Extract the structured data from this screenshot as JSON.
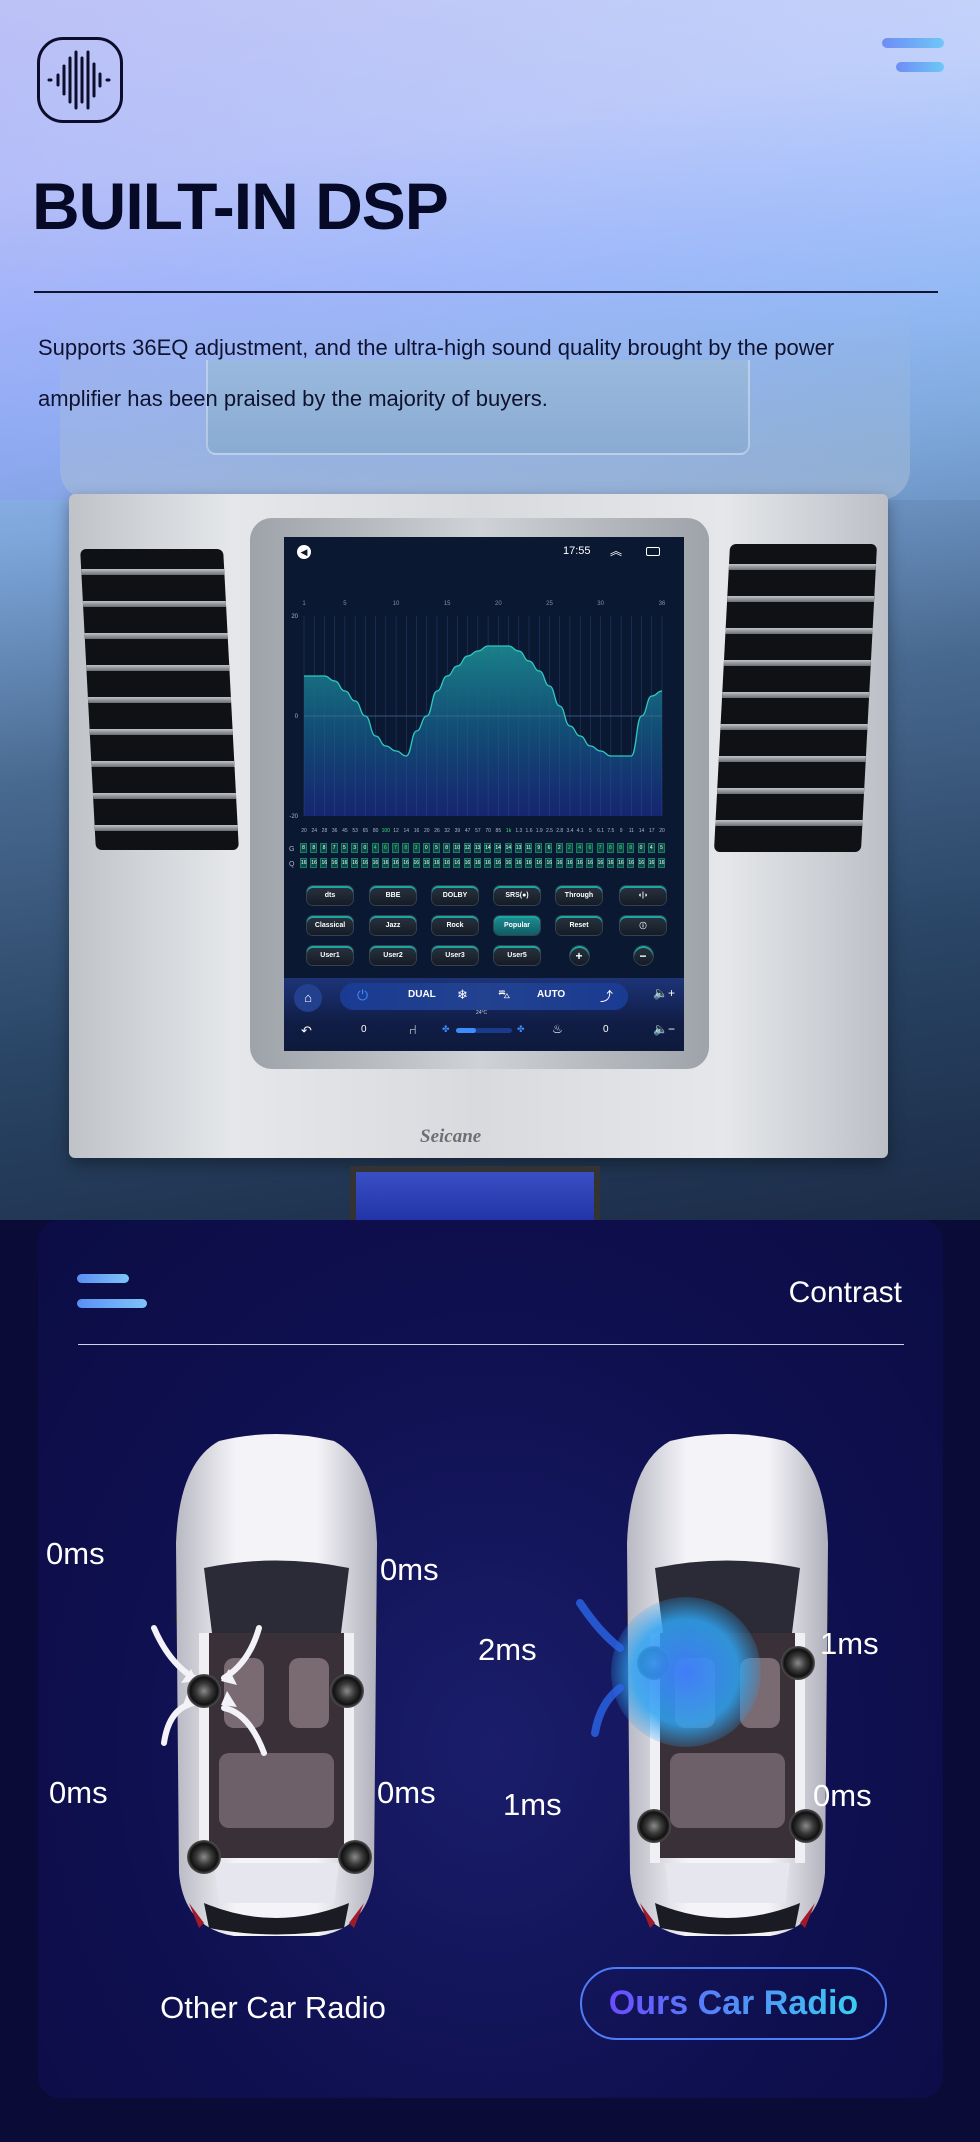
{
  "header": {
    "logo_icon": "sound-wave-icon",
    "menu_icon": "hamburger-icon",
    "title": "BUILT-IN DSP",
    "description": "Supports 36EQ adjustment, and the ultra-high sound quality brought by the power amplifier has been praised by the majority of buyers."
  },
  "device": {
    "brand": "Seicane",
    "status_bar": {
      "time": "17:55",
      "back_icon": "back-circle-icon",
      "up_icon": "double-chevron-up-icon",
      "window_icon": "recent-apps-icon"
    },
    "eq": {
      "band_ticks": [
        "1",
        "5",
        "10",
        "15",
        "20",
        "25",
        "30",
        "36"
      ],
      "y_ticks": [
        "20",
        "0",
        "-20"
      ],
      "ylim": [
        -20,
        20
      ],
      "gains_db": [
        8,
        8,
        8,
        7,
        5,
        3,
        0,
        -4,
        -6,
        -7,
        -8,
        -3,
        0,
        5,
        8,
        10,
        12,
        13,
        14,
        14,
        14,
        13,
        11,
        9,
        6,
        2,
        -2,
        -4,
        -6,
        -7,
        -8,
        -8,
        -8,
        0,
        4,
        5
      ],
      "frequencies": [
        "20",
        "24",
        "28",
        "36",
        "45",
        "53",
        "65",
        "80",
        "100",
        "12",
        "14",
        "16",
        "20",
        "26",
        "32",
        "39",
        "47",
        "57",
        "70",
        "85",
        "1k",
        "1.3",
        "1.6",
        "1.9",
        "2.5",
        "2.8",
        "3.4",
        "4.1",
        "5",
        "6.1",
        "7.5",
        "9",
        "11",
        "14",
        "17",
        "20"
      ],
      "highlighted_frequencies": [
        8,
        20
      ],
      "g_label": "G",
      "q_label": "Q",
      "q_values": [
        16,
        16,
        16,
        16,
        16,
        16,
        16,
        16,
        16,
        16,
        16,
        16,
        16,
        16,
        16,
        16,
        16,
        16,
        16,
        16,
        16,
        16,
        16,
        16,
        16,
        16,
        16,
        16,
        16,
        16,
        16,
        16,
        16,
        16,
        16,
        16
      ],
      "line_color": "#2fc9c0",
      "fill_color": "#1a8d92"
    },
    "presets": [
      [
        {
          "label": "dts"
        },
        {
          "label": "BBE"
        },
        {
          "label": "DOLBY"
        },
        {
          "label": "SRS(●)"
        },
        {
          "label": "Through"
        },
        {
          "label": "◖|◗",
          "icon": "surround-sound-icon"
        }
      ],
      [
        {
          "label": "Classical"
        },
        {
          "label": "Jazz"
        },
        {
          "label": "Rock"
        },
        {
          "label": "Popular",
          "active": true
        },
        {
          "label": "Reset"
        },
        {
          "label": "ⓘ",
          "icon": "info-icon"
        }
      ],
      [
        {
          "label": "User1"
        },
        {
          "label": "User2"
        },
        {
          "label": "User3"
        },
        {
          "label": "User5"
        },
        {
          "label": "+",
          "icon": "plus-icon",
          "round": true
        },
        {
          "label": "−",
          "icon": "minus-icon",
          "round": true
        }
      ]
    ],
    "climate": {
      "dual": "DUAL",
      "auto": "AUTO",
      "temperature": "24°C",
      "left_seat_level": "0",
      "right_seat_level": "0",
      "fan_level": 0.35
    }
  },
  "contrast": {
    "menu_icon": "hamburger-icon",
    "title": "Contrast",
    "other": {
      "label": "Other Car Radio",
      "delays": [
        "0ms",
        "0ms",
        "0ms",
        "0ms"
      ]
    },
    "ours": {
      "label": "Ours Car Radio",
      "delays": [
        "2ms",
        "1ms",
        "1ms",
        "0ms"
      ]
    }
  }
}
